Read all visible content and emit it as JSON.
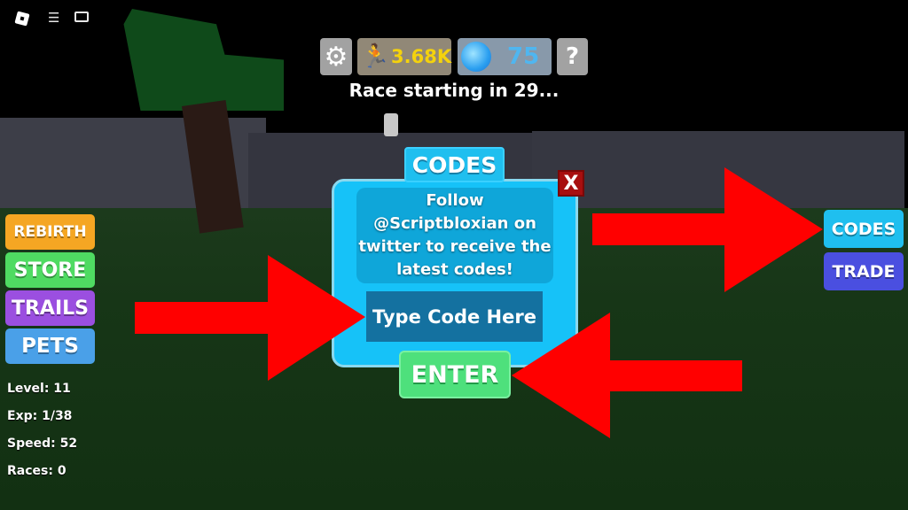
{
  "topbar": {
    "roblox_logo": "roblox-logo-icon",
    "menu_icon": "hamburger-menu-icon",
    "chat_icon": "chat-icon"
  },
  "hud": {
    "settings_icon": "⚙",
    "speed_icon": "running-man-icon",
    "speed_value": "3.68K",
    "gems_icon": "gem-icon",
    "gems_value": "75",
    "help_label": "?",
    "race_status": "Race starting in 29..."
  },
  "codes_dialog": {
    "title": "CODES",
    "close_label": "X",
    "message": "Follow @Scriptbloxian on twitter to receive the latest codes!",
    "input_value": "",
    "input_placeholder": "Type Code Here",
    "enter_label": "ENTER"
  },
  "left_menu": [
    {
      "label": "REBIRTH",
      "color": "#f5a623"
    },
    {
      "label": "STORE",
      "color": "#4fdb62"
    },
    {
      "label": "TRAILS",
      "color": "#9b4fe0"
    },
    {
      "label": "PETS",
      "color": "#4aa0e8"
    }
  ],
  "right_menu": [
    {
      "label": "CODES",
      "color": "#1fbfef"
    },
    {
      "label": "TRADE",
      "color": "#4a4fe0"
    }
  ],
  "stats": {
    "level": "Level: 11",
    "exp": "Exp: 1/38",
    "speed": "Speed: 52",
    "races": "Races: 0"
  },
  "annotation_color": "#ff0000"
}
